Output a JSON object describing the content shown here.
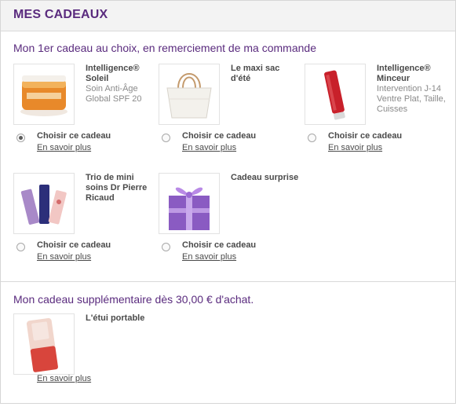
{
  "header": {
    "title": "MES CADEAUX"
  },
  "section1": {
    "title": "Mon 1er cadeau au choix, en remerciement de ma commande",
    "choose_label": "Choisir ce cadeau",
    "more_label": "En savoir plus",
    "gifts": [
      {
        "name": "Intelligence® Soleil",
        "desc": "Soin Anti-Âge Global SPF 20",
        "selected": true
      },
      {
        "name": "Le maxi sac d'été",
        "desc": "",
        "selected": false
      },
      {
        "name": "Intelligence® Minceur",
        "desc": "Intervention J-14 Ventre Plat, Taille, Cuisses",
        "selected": false
      },
      {
        "name": "Trio de mini soins Dr Pierre Ricaud",
        "desc": "",
        "selected": false
      },
      {
        "name": "Cadeau surprise",
        "desc": "",
        "selected": false
      }
    ]
  },
  "section2": {
    "title": "Mon cadeau supplémentaire dès 30,00 € d'achat.",
    "more_label": "En savoir plus",
    "gift": {
      "name": "L'étui portable"
    }
  },
  "colors": {
    "accent": "#5a2b7e",
    "header_bg": "#f3f3f3",
    "divider": "#d9d9d9"
  }
}
